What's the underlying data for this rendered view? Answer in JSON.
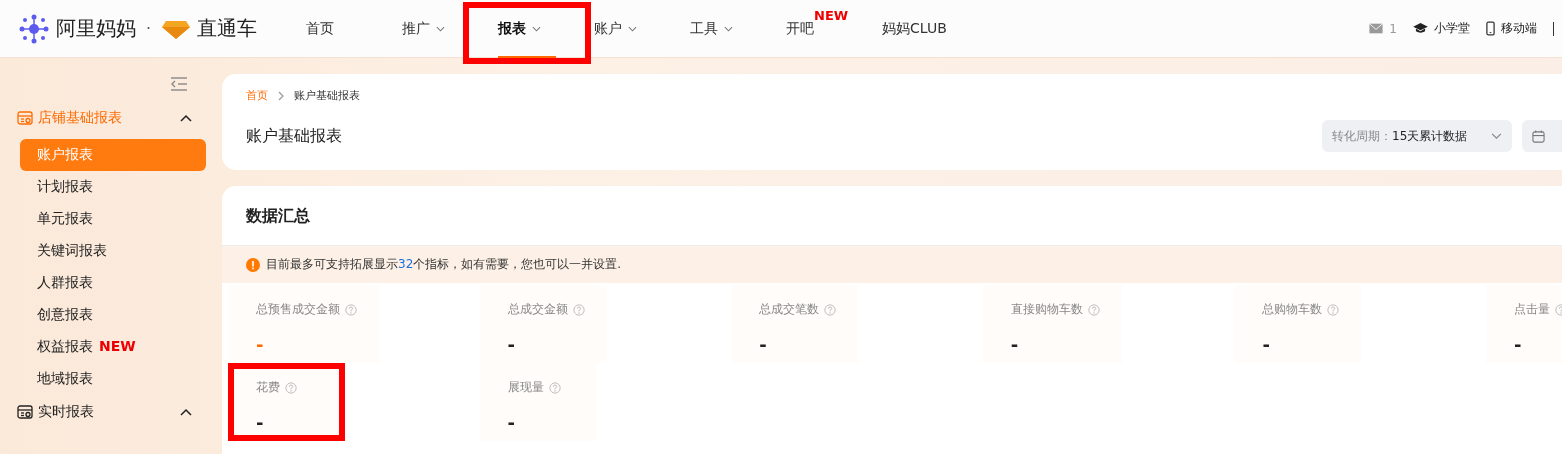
{
  "header": {
    "brand": "阿里妈妈",
    "separator": "·",
    "product": "直通车",
    "nav": [
      {
        "label": "首页",
        "dropdown": false,
        "selected": false,
        "highlighted": false
      },
      {
        "label": "推广",
        "dropdown": true,
        "selected": false,
        "highlighted": false
      },
      {
        "label": "报表",
        "dropdown": true,
        "selected": true,
        "highlighted": true
      },
      {
        "label": "账户",
        "dropdown": true,
        "selected": false,
        "highlighted": false
      },
      {
        "label": "工具",
        "dropdown": true,
        "selected": false,
        "highlighted": false
      },
      {
        "label": "开吧",
        "dropdown": false,
        "selected": false,
        "highlighted": false,
        "badge": "NEW"
      },
      {
        "label": "妈妈CLUB",
        "dropdown": false,
        "selected": false,
        "highlighted": false
      }
    ],
    "message_count": "1",
    "school": "小学堂",
    "mobile": "移动端"
  },
  "sidebar": {
    "groups": [
      {
        "label": "店铺基础报表",
        "expanded": true,
        "selected": true,
        "items": [
          {
            "label": "账户报表",
            "selected": true
          },
          {
            "label": "计划报表",
            "selected": false
          },
          {
            "label": "单元报表",
            "selected": false
          },
          {
            "label": "关键词报表",
            "selected": false
          },
          {
            "label": "人群报表",
            "selected": false
          },
          {
            "label": "创意报表",
            "selected": false
          },
          {
            "label": "权益报表",
            "selected": false,
            "badge": "NEW"
          },
          {
            "label": "地域报表",
            "selected": false
          }
        ]
      },
      {
        "label": "实时报表",
        "expanded": true,
        "selected": false
      }
    ]
  },
  "breadcrumb": [
    "首页",
    "账户基础报表"
  ],
  "page_title": "账户基础报表",
  "period": {
    "label": "转化周期：",
    "value": "15天累计数据"
  },
  "summary": {
    "title": "数据汇总",
    "notice": {
      "before": "目前最多可支持拓展显示",
      "count": "32",
      "after": "个指标，如有需要，您也可以一并设置."
    },
    "metrics": [
      {
        "label": "总预售成交金额",
        "value": "-",
        "accent": true,
        "highlighted": false
      },
      {
        "label": "总成交金额",
        "value": "-",
        "accent": false,
        "highlighted": false
      },
      {
        "label": "总成交笔数",
        "value": "-",
        "accent": false,
        "highlighted": false
      },
      {
        "label": "直接购物车数",
        "value": "-",
        "accent": false,
        "highlighted": false
      },
      {
        "label": "总购物车数",
        "value": "-",
        "accent": false,
        "highlighted": false
      },
      {
        "label": "点击量",
        "value": "-",
        "accent": false,
        "highlighted": false
      },
      {
        "label": "花费",
        "value": "-",
        "accent": false,
        "highlighted": true
      },
      {
        "label": "展现量",
        "value": "-",
        "accent": false,
        "highlighted": false
      }
    ]
  }
}
